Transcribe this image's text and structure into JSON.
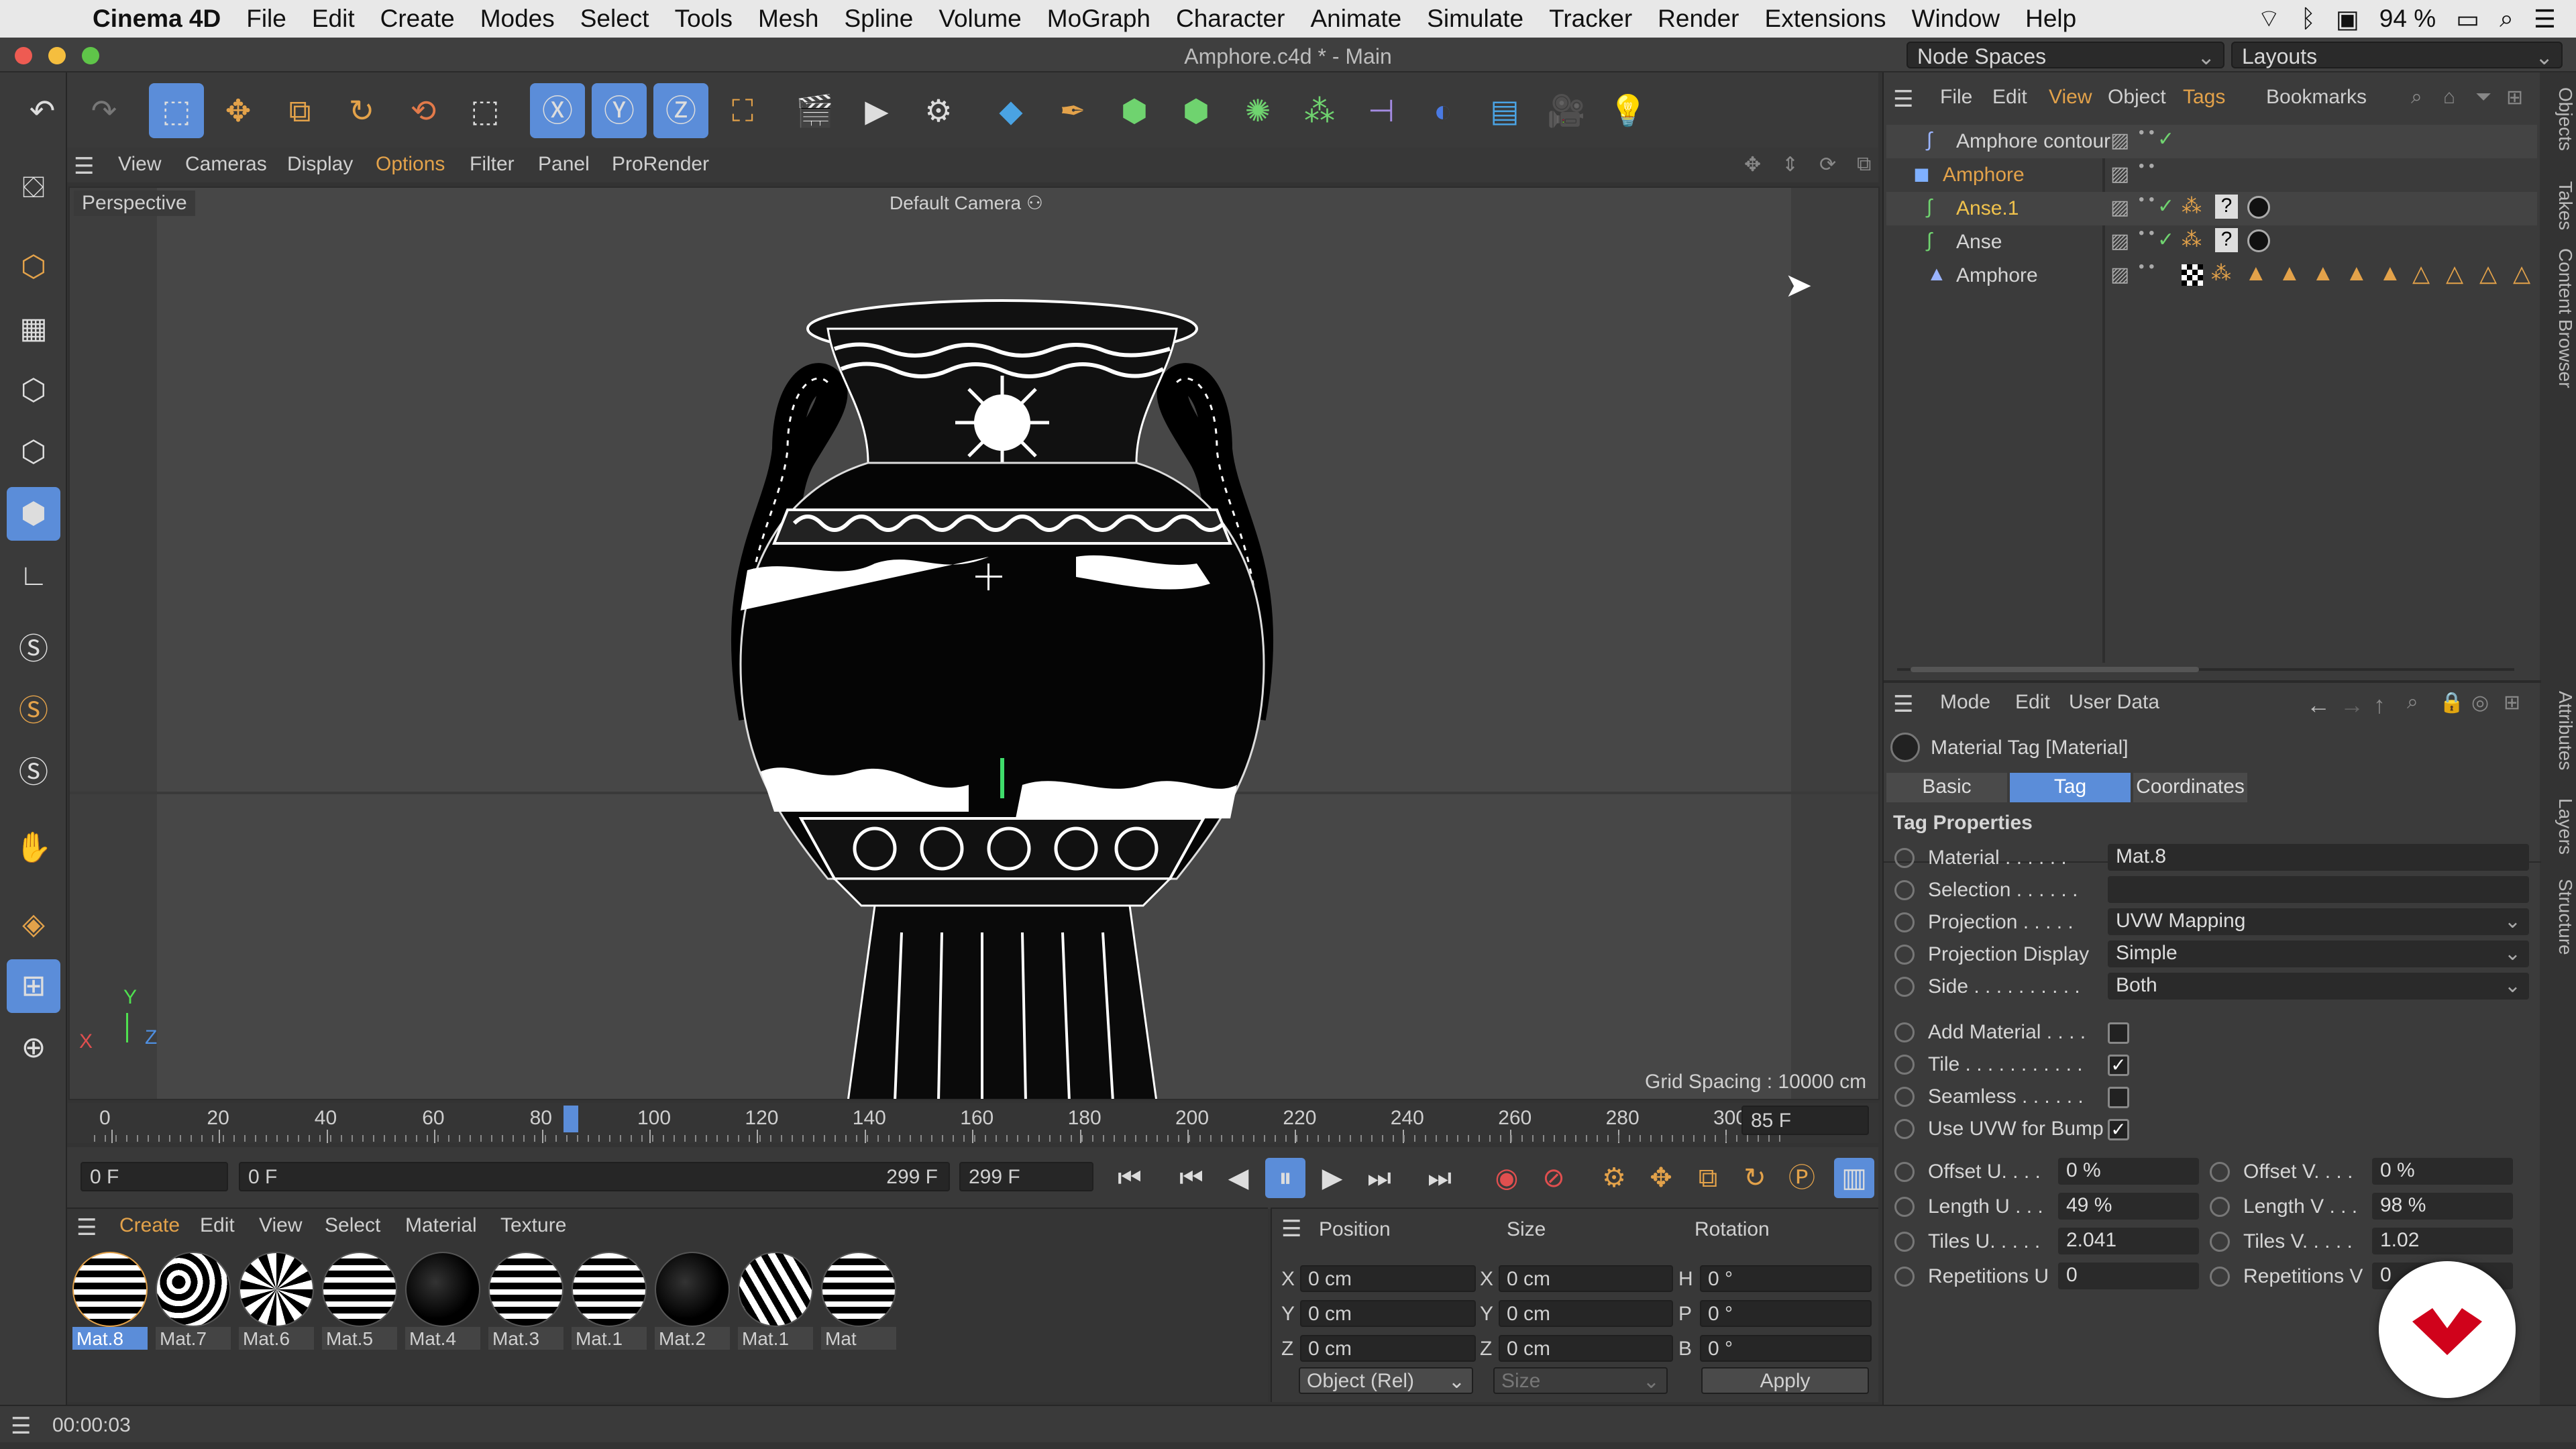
{
  "menubar": {
    "app": "Cinema 4D",
    "items": [
      "File",
      "Edit",
      "Create",
      "Modes",
      "Select",
      "Tools",
      "Mesh",
      "Spline",
      "Volume",
      "MoGraph",
      "Character",
      "Animate",
      "Simulate",
      "Tracker",
      "Render",
      "Extensions",
      "Window",
      "Help"
    ],
    "battery": "94 %"
  },
  "window": {
    "title": "Amphore.c4d * - Main",
    "node_spaces": "Node Spaces",
    "layouts": "Layouts"
  },
  "viewport": {
    "menu": [
      "View",
      "Cameras",
      "Display",
      "Options",
      "Filter",
      "Panel",
      "ProRender"
    ],
    "active_menu": "Options",
    "label": "Perspective",
    "camera": "Default Camera",
    "grid_spacing": "Grid Spacing : 10000 cm",
    "axes": {
      "y": "Y",
      "x": "X",
      "z": "Z"
    }
  },
  "timeline": {
    "ticks": [
      "0",
      "20",
      "40",
      "60",
      "80",
      "100",
      "120",
      "140",
      "160",
      "180",
      "200",
      "220",
      "240",
      "260",
      "280",
      "300"
    ],
    "current_frame": 85,
    "frame_field": "85 F",
    "start_field": "0 F",
    "range_start": "0 F",
    "range_end": "299 F",
    "end_field": "299 F"
  },
  "materials": {
    "menu": [
      "Create",
      "Edit",
      "View",
      "Select",
      "Material",
      "Texture"
    ],
    "items": [
      "Mat.8",
      "Mat.7",
      "Mat.6",
      "Mat.5",
      "Mat.4",
      "Mat.3",
      "Mat.1",
      "Mat.2",
      "Mat.1",
      "Mat"
    ],
    "selected": 0
  },
  "coordinates": {
    "headers": [
      "Position",
      "Size",
      "Rotation"
    ],
    "rows": [
      {
        "label": "X",
        "pos": "0 cm",
        "slabel": "X",
        "size": "0 cm",
        "rlabel": "H",
        "rot": "0 °"
      },
      {
        "label": "Y",
        "pos": "0 cm",
        "slabel": "Y",
        "size": "0 cm",
        "rlabel": "P",
        "rot": "0 °"
      },
      {
        "label": "Z",
        "pos": "0 cm",
        "slabel": "Z",
        "size": "0 cm",
        "rlabel": "B",
        "rot": "0 °"
      }
    ],
    "mode": "Object (Rel)",
    "size_mode": "Size",
    "apply": "Apply"
  },
  "status": {
    "time": "00:00:03"
  },
  "objects": {
    "menu": [
      "File",
      "Edit",
      "View",
      "Object",
      "Tags",
      "Bookmarks"
    ],
    "items": [
      {
        "name": "Amphore contour",
        "color": "#d4d4d4"
      },
      {
        "name": "Amphore",
        "color": "#e3a24a"
      },
      {
        "name": "Anse.1",
        "color": "#f0c24c"
      },
      {
        "name": "Anse",
        "color": "#d4d4d4"
      },
      {
        "name": "Amphore",
        "color": "#d4d4d4"
      }
    ],
    "side_tabs": [
      "Objects",
      "Takes",
      "Content Browser"
    ]
  },
  "attributes": {
    "menu": [
      "Mode",
      "Edit",
      "User Data"
    ],
    "header": "Material Tag [Material]",
    "tabs": [
      "Basic",
      "Tag",
      "Coordinates"
    ],
    "active_tab": "Tag",
    "section": "Tag Properties",
    "props": [
      {
        "label": "Material . . . . . .",
        "value": "Mat.8"
      },
      {
        "label": "Selection . . . . . .",
        "value": ""
      },
      {
        "label": "Projection . . . . .",
        "value": "UVW Mapping"
      },
      {
        "label": "Projection Display",
        "value": "Simple"
      },
      {
        "label": "Side . . . . . . . . . .",
        "value": "Both"
      }
    ],
    "checks": [
      {
        "label": "Add Material . . . .",
        "checked": false
      },
      {
        "label": "Tile . . . . . . . . . . .",
        "checked": true
      },
      {
        "label": "Seamless . . . . . .",
        "checked": false
      },
      {
        "label": "Use UVW for Bump",
        "checked": true
      }
    ],
    "pairs": [
      {
        "l1": "Offset U. . . .",
        "v1": "0 %",
        "l2": "Offset V. . . .",
        "v2": "0 %"
      },
      {
        "l1": "Length U . . .",
        "v1": "49 %",
        "l2": "Length V . . .",
        "v2": "98 %"
      },
      {
        "l1": "Tiles U. . . . .",
        "v1": "2.041",
        "l2": "Tiles V. . . . .",
        "v2": "1.02"
      },
      {
        "l1": "Repetitions U",
        "v1": "0",
        "l2": "Repetitions V",
        "v2": "0"
      }
    ],
    "side_tabs": [
      "Attributes",
      "Layers",
      "Structure"
    ]
  },
  "colors": {
    "accent": "#5b8dd9",
    "selected": "#e3a24a",
    "bg": "#333333"
  }
}
